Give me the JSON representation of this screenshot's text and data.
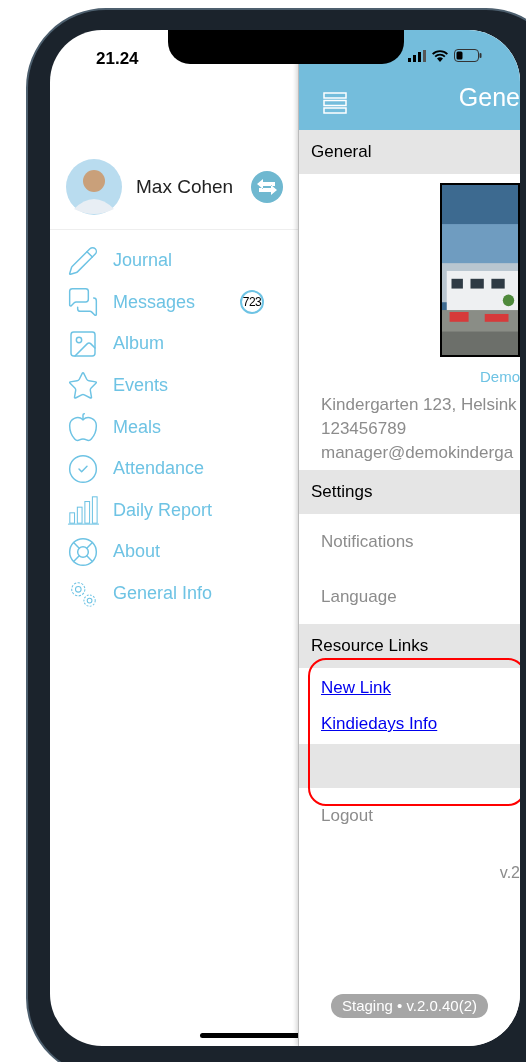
{
  "status_bar": {
    "time": "21.24"
  },
  "sidebar": {
    "profile": {
      "name": "Max Cohen"
    },
    "items": [
      {
        "label": "Journal"
      },
      {
        "label": "Messages",
        "badge": "723"
      },
      {
        "label": "Album"
      },
      {
        "label": "Events"
      },
      {
        "label": "Meals"
      },
      {
        "label": "Attendance"
      },
      {
        "label": "Daily Report"
      },
      {
        "label": "About"
      },
      {
        "label": "General Info"
      }
    ]
  },
  "header": {
    "title": "Gene"
  },
  "sections": [
    {
      "kind": "header",
      "label": "General"
    },
    {
      "kind": "info",
      "caption": "Demo",
      "lines": [
        "Kindergarten 123, Helsink",
        "123456789",
        "manager@demokinderga"
      ]
    },
    {
      "kind": "header",
      "label": "Settings"
    },
    {
      "kind": "row",
      "label": "Notifications"
    },
    {
      "kind": "row",
      "label": "Language"
    },
    {
      "kind": "header",
      "label": "Resource Links"
    },
    {
      "kind": "links",
      "items": [
        "New Link",
        "Kindiedays Info"
      ]
    },
    {
      "kind": "spacer"
    },
    {
      "kind": "row",
      "label": "Logout"
    },
    {
      "kind": "version",
      "label": "v.2"
    }
  ],
  "footer": {
    "badge": "Staging • v.2.0.40(2)"
  }
}
